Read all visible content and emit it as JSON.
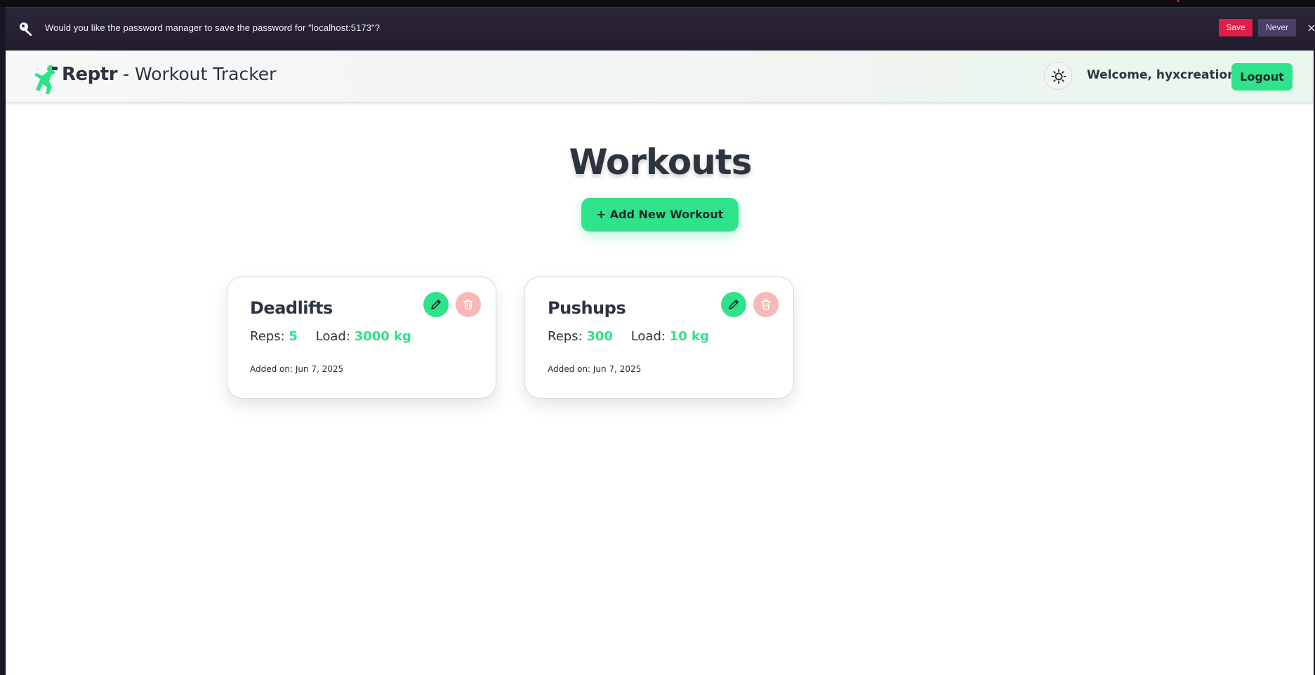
{
  "password_prompt": {
    "message": "Would you like the password manager to save the password for \"localhost:5173\"?",
    "save_label": "Save",
    "never_label": "Never",
    "close_glyph": "×",
    "icon": "key-icon"
  },
  "navbar": {
    "brand_name": "Reptr",
    "brand_suffix": " - Workout Tracker",
    "logo_icon": "runner-logo-icon",
    "theme_icon": "sun-icon",
    "welcome_text": "Welcome, hyxcreation!",
    "logout_label": "Logout"
  },
  "main": {
    "title": "Workouts",
    "add_button_label": "+ Add New Workout",
    "workouts": [
      {
        "name": "Deadlifts",
        "reps_label": "Reps:",
        "reps_value": "5",
        "load_label": "Load:",
        "load_value": "3000 kg",
        "added": "Added on: Jun 7, 2025"
      },
      {
        "name": "Pushups",
        "reps_label": "Reps:",
        "reps_value": "300",
        "load_label": "Load:",
        "load_value": "10 kg",
        "added": "Added on: Jun 7, 2025"
      }
    ]
  },
  "colors": {
    "accent": "#2ee38a",
    "danger_soft": "#f9b7b7",
    "text_dark": "#2c3440",
    "prompt_save": "#e11d48",
    "prompt_never": "#4a3f66"
  }
}
